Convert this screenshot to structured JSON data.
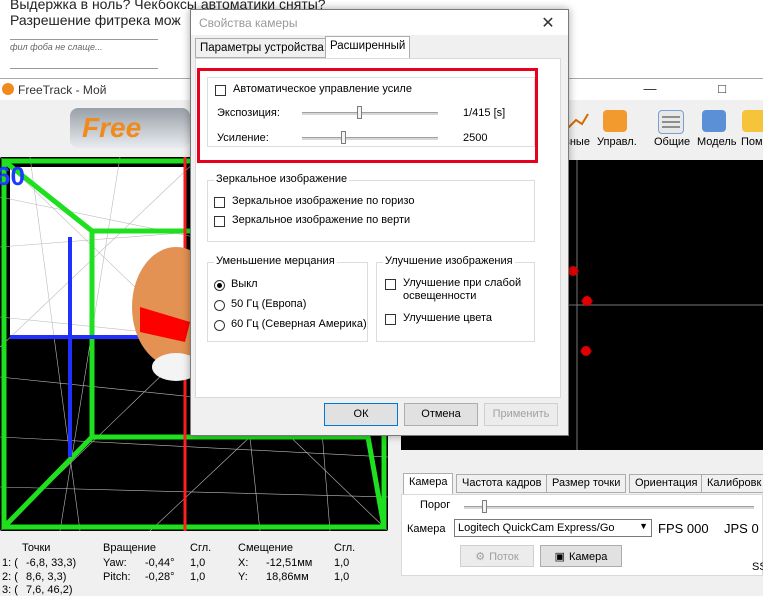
{
  "forum": {
    "line1": "Выдержка в ноль? Чекбоксы автоматики сняты?",
    "line2": "Разрешение фитрека мож",
    "signature": "фил фоба не слаще..."
  },
  "freetrack": {
    "title": "FreeTrack - Мой",
    "logo_text": "Free",
    "view_number": "60",
    "toolbar": [
      "вные",
      "Управл.",
      "Общие",
      "Модель",
      "Пом"
    ],
    "tabs": [
      "Камера",
      "Частота кадров",
      "Размер точки",
      "Ориентация",
      "Калибровк"
    ],
    "threshold_label": "Порог",
    "camera_label": "Камера",
    "camera_value": "Logitech QuickCam Express/Go",
    "fps": "FPS 000",
    "jps": "JPS 0",
    "stream_button": "Поток",
    "camera_button": "Камера",
    "status_fragment": "SS",
    "stats": {
      "headers": [
        "Точки",
        "Вращение",
        "Сгл.",
        "Смещение",
        "Сгл."
      ],
      "rows": [
        {
          "id": "1: (",
          "point": "-6,8,  33,3)",
          "rot_label": "Yaw:",
          "rot": "-0,44°",
          "smooth1": "1,0",
          "off_label": "X:",
          "off": "-12,51мм",
          "smooth2": "1,0"
        },
        {
          "id": "2: (",
          "point": "8,6,   3,3)",
          "rot_label": "Pitch:",
          "rot": "-0,28°",
          "smooth1": "1,0",
          "off_label": "Y:",
          "off": "18,86мм",
          "smooth2": "1,0"
        },
        {
          "id": "3: (",
          "point": "7,6,  46,2)",
          "rot_label": "",
          "rot": "",
          "smooth1": "",
          "off_label": "",
          "off": "",
          "smooth2": ""
        }
      ]
    }
  },
  "dialog": {
    "title": "Свойства камеры",
    "tabs": [
      "Параметры устройства",
      "Расширенный"
    ],
    "auto_gain_label": "Автоматическое управление усиле",
    "exposure_label": "Экспозиция:",
    "exposure_value": "1/415 [s]",
    "exposure_level": 0.42,
    "gain_label": "Усиление:",
    "gain_value": "2500",
    "gain_level": 0.3,
    "mirror_group": "Зеркальное изображение",
    "mirror_h": "Зеркальное изображение по горизо",
    "mirror_v": "Зеркальное изображение по верти",
    "flicker_group": "Уменьшение мерцания",
    "flicker_options": [
      "Выкл",
      "50 Гц (Европа)",
      "60 Гц (Северная Америка)"
    ],
    "flicker_selected": 0,
    "enhance_group": "Улучшение изображения",
    "enhance_low_light": "Улучшение при слабой освещенности",
    "enhance_color": "Улучшение цвета",
    "ok": "ОК",
    "cancel": "Отмена",
    "apply": "Применить"
  },
  "colors": {
    "highlight": "#e8001c",
    "wire_green": "#1ee01e",
    "marker_red": "#e00000"
  }
}
